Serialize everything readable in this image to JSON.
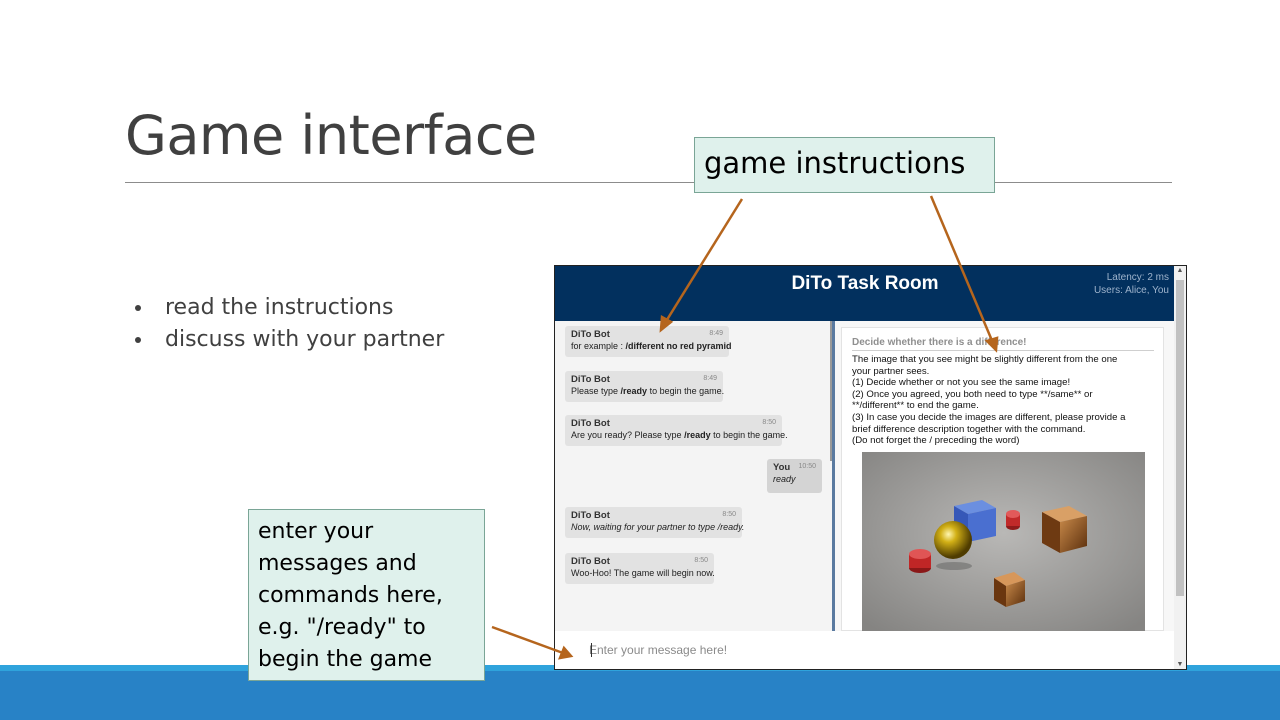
{
  "slide": {
    "title": "Game interface",
    "bullets": [
      "read the instructions",
      "discuss with your partner"
    ]
  },
  "callouts": {
    "top": "game instructions",
    "bottom_lines": [
      "enter your",
      "messages and",
      "commands here,",
      "e.g. \"/ready\" to",
      "begin the game"
    ]
  },
  "app": {
    "title": "DiTo Task Room",
    "latency": "Latency: 2 ms",
    "users": "Users: Alice, You",
    "messages": [
      {
        "sender": "DiTo Bot",
        "time": "8:49",
        "pre": "for example : ",
        "bold": "/different no red pyramid",
        "post": ""
      },
      {
        "sender": "DiTo Bot",
        "time": "8:49",
        "pre": "Please type ",
        "bold": "/ready",
        "post": " to begin the game."
      },
      {
        "sender": "DiTo Bot",
        "time": "8:50",
        "pre": "Are you ready? Please type ",
        "bold": "/ready",
        "post": " to begin the game."
      },
      {
        "sender": "You",
        "time": "10:50",
        "text": "ready"
      },
      {
        "sender": "DiTo Bot",
        "time": "8:50",
        "text": "Now, waiting for your partner to type /ready."
      },
      {
        "sender": "DiTo Bot",
        "time": "8:50",
        "text": "Woo-Hoo! The game will begin now."
      }
    ],
    "task": {
      "heading": "Decide whether there is a difference!",
      "lines": [
        "The image that you see might be slightly different from the one",
        "your partner sees.",
        "(1) Decide whether or not you see the same image!",
        "(2) Once you agreed, you both need to type **/same** or",
        "**/different** to end the game.",
        "(3) In case you decide the images are different, please provide a",
        "brief difference description together with the command.",
        "(Do not forget the / preceding the word)"
      ]
    },
    "input_placeholder": "Enter your message here!"
  },
  "colors": {
    "header": "#02305e",
    "footer": "#2882c6",
    "arrow": "#b5651d",
    "callout_bg": "#dff1ec"
  }
}
